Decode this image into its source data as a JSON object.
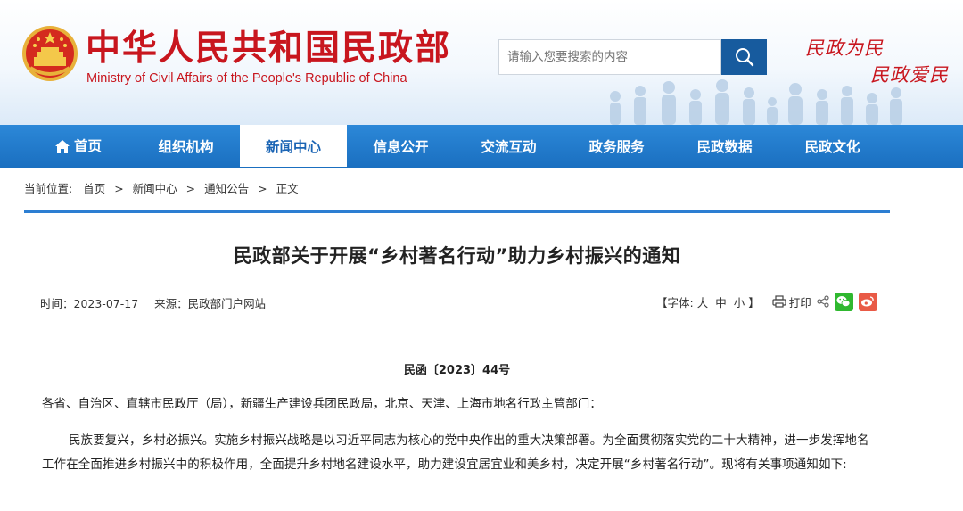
{
  "header": {
    "site_title": "中华人民共和国民政部",
    "site_subtitle": "Ministry of Civil Affairs of the People's Republic of China",
    "search_placeholder": "请输入您要搜索的内容",
    "slogan_line1": "民政为民",
    "slogan_line2": "民政爱民",
    "brand_color": "#c8161e",
    "icons": [
      "national-emblem-icon",
      "search-icon"
    ]
  },
  "nav": {
    "items": [
      {
        "label": "首页",
        "icon": "home-icon"
      },
      {
        "label": "组织机构"
      },
      {
        "label": "新闻中心",
        "active": true
      },
      {
        "label": "信息公开"
      },
      {
        "label": "交流互动"
      },
      {
        "label": "政务服务"
      },
      {
        "label": "民政数据"
      },
      {
        "label": "民政文化"
      }
    ],
    "color": "#1f78c9"
  },
  "breadcrumb": {
    "prefix": "当前位置:",
    "items": [
      "首页",
      "新闻中心",
      "通知公告",
      "正文"
    ],
    "separator": ">"
  },
  "article": {
    "title": "民政部关于开展“乡村著名行动”助力乡村振兴的通知",
    "time": "时间：2023-07-17",
    "source": "来源：民政部门户网站",
    "font_size_label": "【字体:",
    "font_sizes": [
      "大",
      "中",
      "小"
    ],
    "font_size_close": "】",
    "print_label": "打印",
    "share_icons": [
      "share-icon",
      "wechat-icon",
      "weibo-icon"
    ],
    "doc_number": "民函〔2023〕44号",
    "addressee": "各省、自治区、直辖市民政厅（局），新疆生产建设兵团民政局，北京、天津、上海市地名行政主管部门：",
    "body": "民族要复兴，乡村必振兴。实施乡村振兴战略是以习近平同志为核心的党中央作出的重大决策部署。为全面贯彻落实党的二十大精神，进一步发挥地名工作在全面推进乡村振兴中的积极作用，全面提升乡村地名建设水平，助力建设宜居宜业和美乡村，决定开展“乡村著名行动”。现将有关事项通知如下:"
  }
}
